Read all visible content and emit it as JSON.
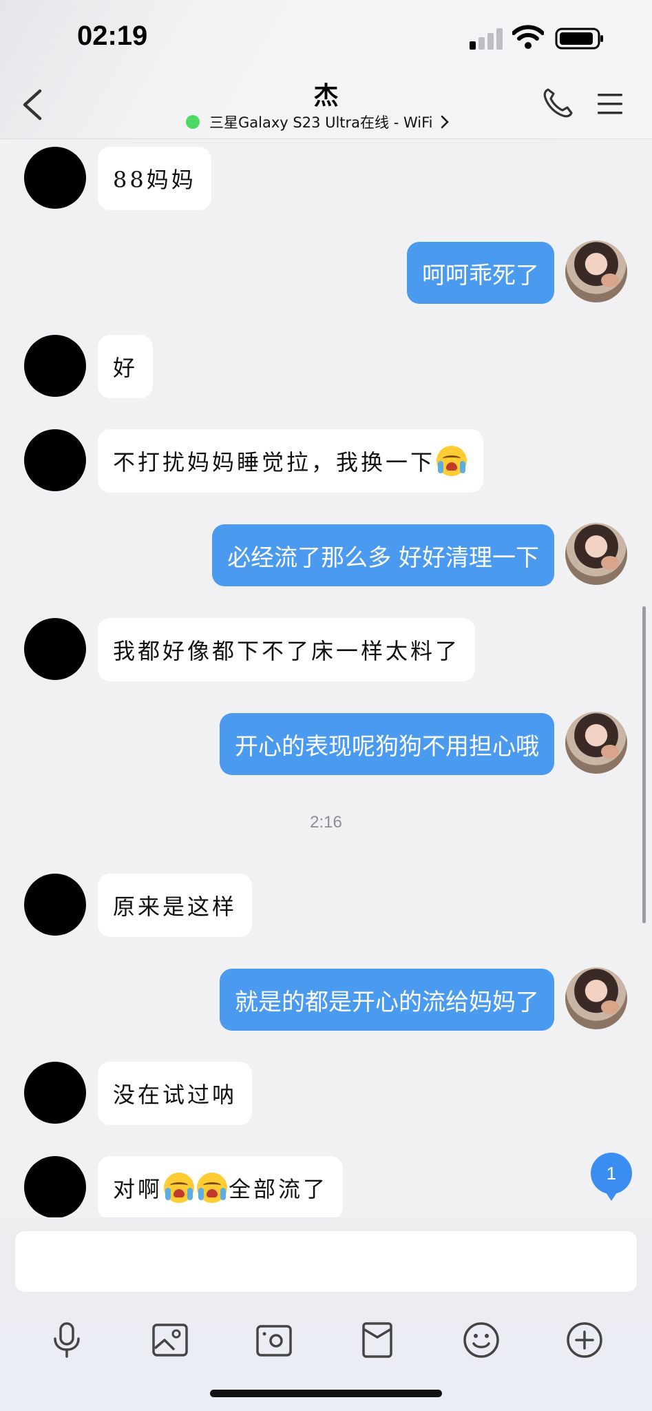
{
  "status_bar": {
    "time": "02:19"
  },
  "header": {
    "title": "杰",
    "subtitle": "三星Galaxy S23 Ultra在线 - WiFi"
  },
  "messages": [
    {
      "side": "in",
      "text": "88妈妈"
    },
    {
      "side": "out",
      "text": "呵呵乖死了"
    },
    {
      "side": "in",
      "text": "好"
    },
    {
      "side": "in",
      "text": "不打扰妈妈睡觉拉，我换一下"
    },
    {
      "side": "out",
      "text": "必经流了那么多 好好清理一下"
    },
    {
      "side": "in",
      "text": "我都好像都下不了床一样太料了"
    },
    {
      "side": "out",
      "text": "开心的表现呢狗狗不用担心哦"
    },
    {
      "side": "time",
      "text": "2:16"
    },
    {
      "side": "in",
      "text": "原来是这样"
    },
    {
      "side": "out",
      "text": "就是的都是开心的流给妈妈了"
    },
    {
      "side": "in",
      "text": "没在试过呐"
    },
    {
      "side": "in",
      "text_a": "对啊",
      "text_b": "全部流了"
    }
  ],
  "unread_badge": "1",
  "colors": {
    "outgoing_bubble": "#4a9bf0",
    "online_dot": "#4cd964",
    "badge": "#3b8ef0"
  },
  "toolbar": [
    "microphone-icon",
    "image-icon",
    "camera-icon",
    "red-packet-icon",
    "emoji-icon",
    "plus-icon"
  ]
}
